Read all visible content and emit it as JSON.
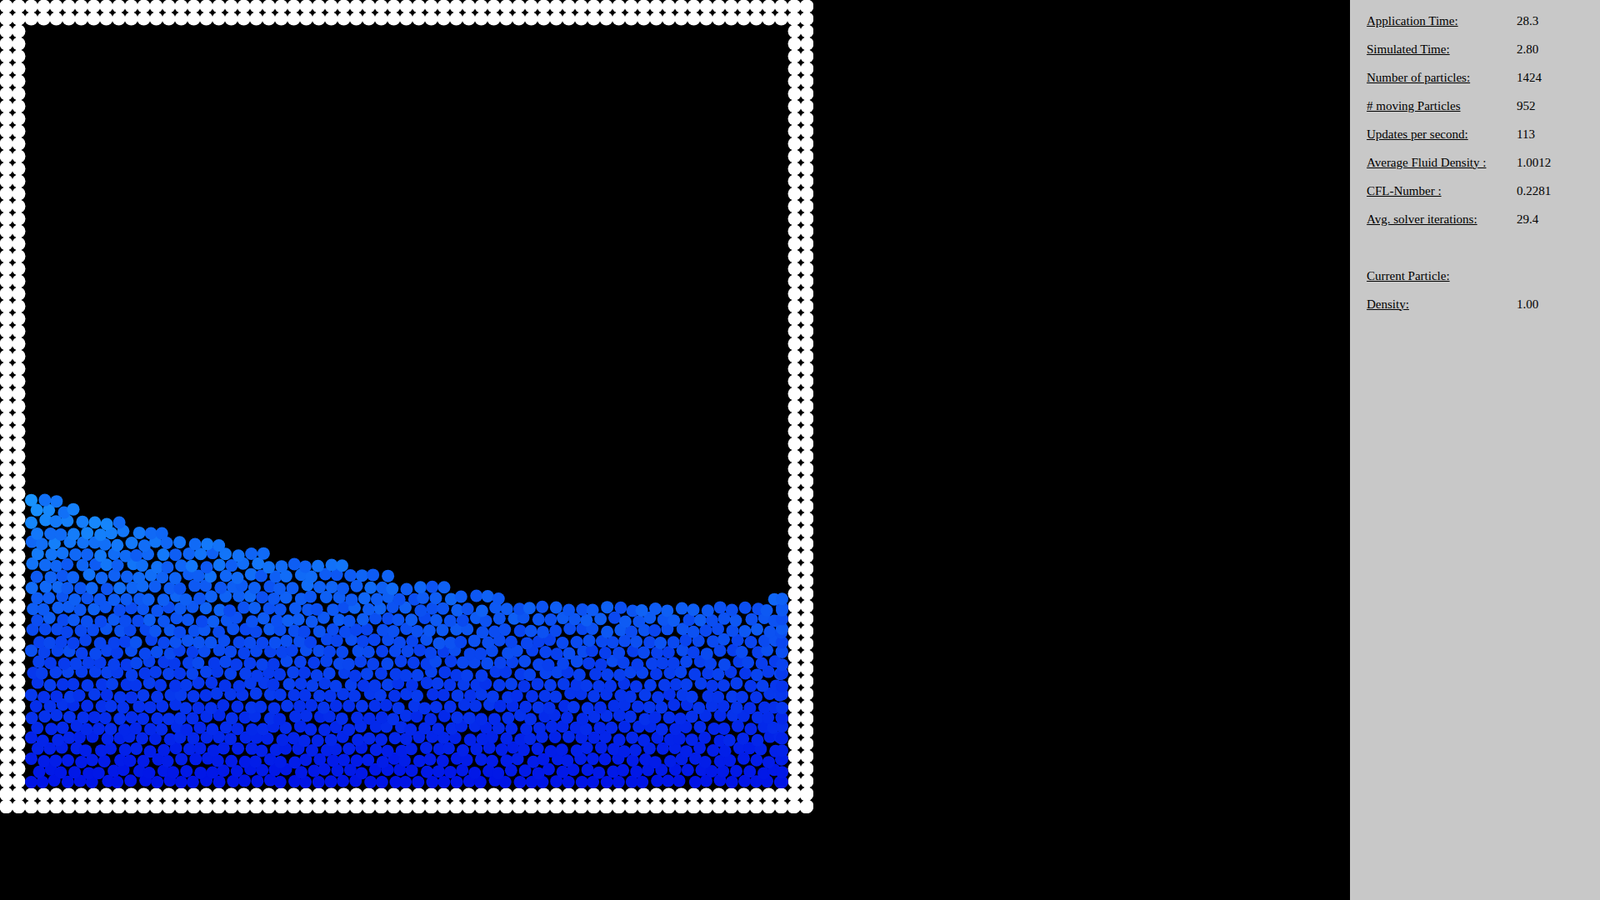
{
  "simulation": {
    "fluid": {
      "surface": [
        0.39,
        0.357,
        0.33,
        0.31,
        0.297,
        0.273,
        0.257,
        0.237,
        0.243,
        0.246,
        0.25
      ]
    }
  },
  "panel": {
    "stats": [
      {
        "label": "Application Time:",
        "value": "28.3"
      },
      {
        "label": "Simulated Time:",
        "value": "2.80"
      },
      {
        "label": "Number of particles:",
        "value": "1424"
      },
      {
        "label": "# moving Particles",
        "value": "952"
      },
      {
        "label": "Updates per second:",
        "value": "113"
      },
      {
        "label": "Average Fluid Density :",
        "value": "1.0012"
      },
      {
        "label": "CFL-Number :",
        "value": "0.2281"
      },
      {
        "label": "Avg. solver iterations:",
        "value": "29.4"
      }
    ],
    "current_particle": {
      "heading": "Current Particle:",
      "stats": [
        {
          "label": "Density:",
          "value": "1.00"
        }
      ]
    }
  }
}
